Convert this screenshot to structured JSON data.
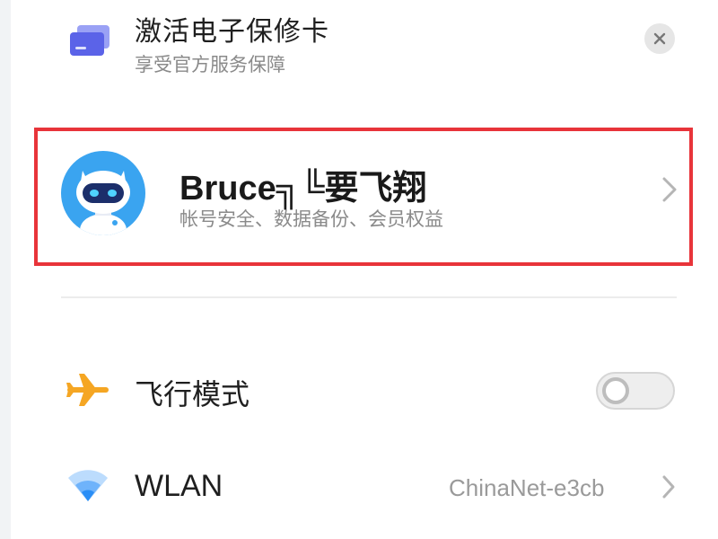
{
  "warranty": {
    "title": "激活电子保修卡",
    "subtitle": "享受官方服务保障",
    "icon": "card-icon",
    "close_icon": "close-icon"
  },
  "account": {
    "name": "Bruce╗╚要飞翔",
    "subtitle": "帐号安全、数据备份、会员权益",
    "avatar": "robot-avatar",
    "chevron": "chevron-right-icon"
  },
  "settings": {
    "airplane": {
      "label": "飞行模式",
      "icon": "airplane-icon",
      "enabled": false
    },
    "wlan": {
      "label": "WLAN",
      "value": "ChinaNet-e3cb",
      "icon": "wifi-icon"
    }
  },
  "colors": {
    "highlight_border": "#e8343a",
    "airplane_icon": "#f5a623",
    "wifi_icon": "#2a8ef6",
    "card_icon": "#5b63e8",
    "avatar_bg": "#3aa4f0"
  }
}
